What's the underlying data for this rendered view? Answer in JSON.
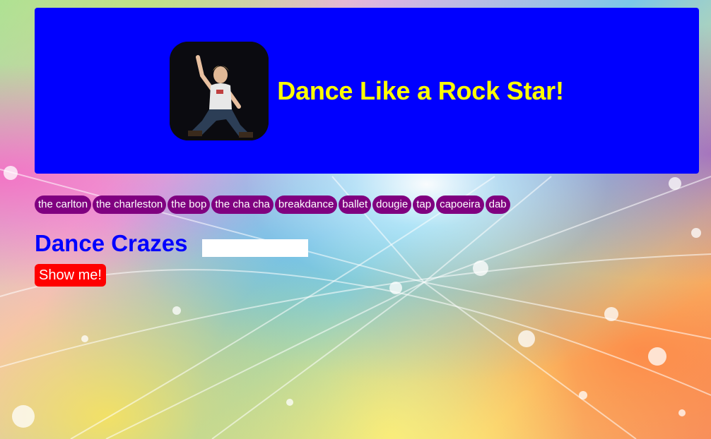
{
  "header": {
    "title": "Dance Like a Rock Star!",
    "logo": "dancing-man-image",
    "background_color": "#0000ff",
    "title_color": "#ffff00"
  },
  "tags": [
    {
      "label": "the carlton"
    },
    {
      "label": "the charleston"
    },
    {
      "label": "the bop"
    },
    {
      "label": "the cha cha"
    },
    {
      "label": "breakdance"
    },
    {
      "label": "ballet"
    },
    {
      "label": "dougie"
    },
    {
      "label": "tap"
    },
    {
      "label": "capoeira"
    },
    {
      "label": "dab"
    }
  ],
  "tag_color": "#800080",
  "section": {
    "title": "Dance Crazes",
    "title_color": "#0000ff"
  },
  "search": {
    "value": "",
    "placeholder": ""
  },
  "show_button": {
    "label": "Show me!",
    "color": "#ff0000"
  }
}
